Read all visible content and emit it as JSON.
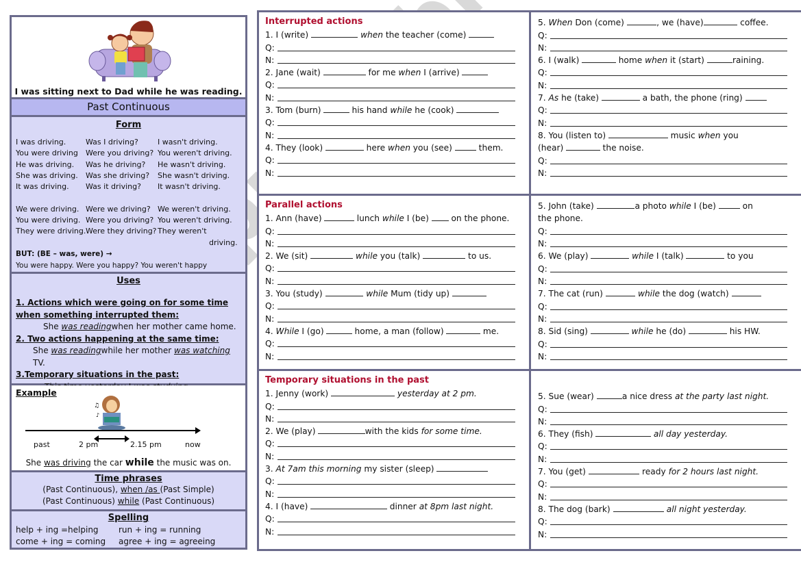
{
  "left": {
    "caption": "I was sitting next to Dad while he was reading.",
    "title": "Past Continuous",
    "form": {
      "heading": "Form",
      "rows": [
        [
          "I was driving.",
          "Was I driving?",
          "I wasn't driving."
        ],
        [
          "You were driving",
          "Were you driving?",
          "You weren't driving."
        ],
        [
          "He was driving.",
          "Was he driving?",
          "He wasn't driving."
        ],
        [
          "She was driving.",
          "Was she driving?",
          "She wasn't driving."
        ],
        [
          "It was driving.",
          "Was it driving?",
          "It wasn't driving."
        ],
        [
          "",
          "",
          ""
        ],
        [
          "We were driving.",
          "Were we driving?",
          "We weren't driving."
        ],
        [
          "You were driving.",
          "Were you driving?",
          "You weren't driving."
        ],
        [
          "They were driving.",
          "Were they driving?",
          "They weren't"
        ],
        [
          "",
          "",
          "driving."
        ]
      ],
      "but_note": "BUT: (BE – was, were) →",
      "but_example": "You were happy.   Were you happy? You weren't happy"
    },
    "uses": {
      "heading": "Uses",
      "items": [
        {
          "label": "1. Actions which were going on for some time when something interrupted them:",
          "example_pre": "She ",
          "example_verb": "was reading",
          "example_post": "when her mother came home."
        },
        {
          "label": "2. Two actions happening at the same time:",
          "example_pre": "She ",
          "example_verb": "was reading",
          "example_mid": "while her mother ",
          "example_verb2": "was watching",
          "example_post": " TV."
        },
        {
          "label": "3.Temporary situations in the past:",
          "example_pre": "This time yesterday I ",
          "example_verb": "was studying",
          "example_post": "."
        }
      ]
    },
    "example": {
      "heading": "Example",
      "timeline_labels": [
        "past",
        "2 pm",
        "2.15 pm",
        "now"
      ],
      "sentence_pre": "She ",
      "sentence_verb": "was driving",
      "sentence_mid": " the car ",
      "sentence_while": "while",
      "sentence_post": " the music was on."
    },
    "time_phrases": {
      "heading": "Time phrases",
      "line1_a": "(Past Continuous), ",
      "line1_b": "when /as ",
      "line1_c": "(Past Simple)",
      "line2_a": "(Past Continuous) ",
      "line2_b": "while",
      "line2_c": " (Past Continuous)"
    },
    "spelling": {
      "heading": "Spelling",
      "rows": [
        [
          "help + ing =helping",
          "run + ing = running"
        ],
        [
          "come + ing = coming",
          "agree + ing = agreeing"
        ]
      ]
    }
  },
  "exercises": {
    "q_label": "Q:",
    "n_label": "N:",
    "sections": [
      {
        "title": "Interrupted actions",
        "left": [
          "1. I (write) ___________ <i>when</i> the teacher (come) ______",
          "2. Jane (wait) __________ for me <i>when</i> I (arrive) ______",
          "3. Tom (burn) ______ his hand <i>while</i> he (cook) __________",
          "4. They (look) _________ here <i>when</i> you (see) _____ them."
        ],
        "right": [
          "5. <i>When</i> Don (come) _______, we (have)________ coffee.",
          "6. I (walk) ________ home <i>when</i> it (start) ______raining.",
          "7. <i>As</i> he (take) _________ a bath, the phone (ring) _____",
          "8. You (listen to) ______________ music <i>when</i> you|(hear) ________ the noise."
        ]
      },
      {
        "title": "Parallel actions",
        "left": [
          "1. Ann (have) _______ lunch <i>while</i> I (be) ____ on the phone.",
          "2. We (sit) __________ <i>while</i> you (talk) __________ to us.",
          "3. You (study) _________ <i>while</i> Mum (tidy up) ________",
          "4. <i>While</i> I (go) ______ home, a man (follow) ________ me."
        ],
        "right": [
          "5. John (take) _________a photo <i>while</i> I (be) _____ on|the phone.",
          "6. We (play) _________ <i>while</i> I (talk) _________ to you",
          "7. The cat (run) _______ <i>while</i> the dog (watch) _______",
          "8. Sid (sing) _________ <i>while</i> he (do) _________ his HW."
        ]
      },
      {
        "title": "Temporary situations in the past",
        "left": [
          "1. Jenny (work) _______________ <i>yesterday at 2 pm.</i>",
          "2. We (play) ___________with the kids <i>for some time.</i>",
          "3. <i>At 7am this morning</i> my sister (sleep) ____________",
          "4. I (have) __________________ dinner <i>at 8pm last night.</i>"
        ],
        "right": [
          "5. Sue (wear) ______a nice dress <i>at the party last night.</i>",
          "6. They (fish) _____________ <i>all day yesterday.</i>",
          "7. You (get) ____________ ready <i>for 2 hours last night.</i>",
          "8. The dog (bark) ____________ <i>all night yesterday.</i>"
        ]
      }
    ]
  },
  "watermark": "ESLprintables.com",
  "colors": {
    "border": "#6b6b8c",
    "panel_bg": "#d9d9f7",
    "title_bg": "#b7b7f0",
    "section_title": "#b01030"
  }
}
